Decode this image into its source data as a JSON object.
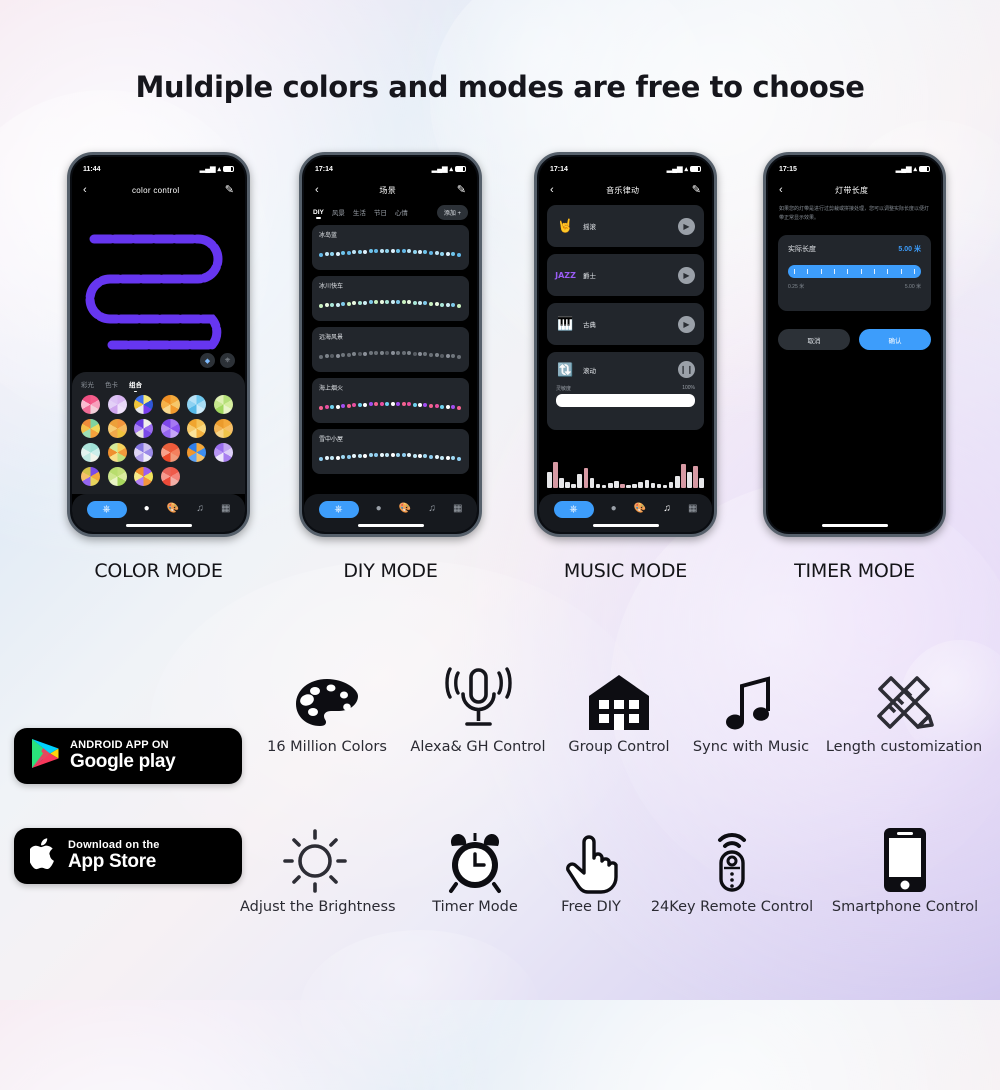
{
  "heading": "Muldiple colors and modes are free to choose",
  "colors": {
    "accent_blue": "#3d9dfb",
    "strip_purple": "#6636f0",
    "phone_bezel": "#56606b",
    "card_dark": "#22262c",
    "panel_dark": "#1d2025"
  },
  "phones": [
    {
      "id": "color-mode",
      "mode_label": "COLOR MODE",
      "status_time": "11:44",
      "nav_title": "color control",
      "back_icon": "chevron-left-icon",
      "edit_icon": "pencil-icon",
      "tabs": [
        {
          "label": "彩光",
          "active": false
        },
        {
          "label": "色卡",
          "active": false
        },
        {
          "label": "组合",
          "active": true
        }
      ],
      "fab_icons": [
        "diamond-icon",
        "power-icon"
      ],
      "swatch_count": 22,
      "tabbar": {
        "power_icon": "power-icon",
        "items": [
          {
            "icon": "bulb-icon",
            "active": true
          },
          {
            "icon": "palette-icon",
            "active": false
          },
          {
            "icon": "music-note-icon",
            "active": false
          },
          {
            "icon": "grid-icon",
            "active": false
          }
        ]
      }
    },
    {
      "id": "diy-mode",
      "mode_label": "DIY MODE",
      "status_time": "17:14",
      "nav_title": "场景",
      "back_icon": "chevron-left-icon",
      "edit_icon": "pencil-icon",
      "category_tabs": [
        {
          "label": "DIY",
          "active": true
        },
        {
          "label": "风景",
          "active": false
        },
        {
          "label": "生活",
          "active": false
        },
        {
          "label": "节日",
          "active": false
        },
        {
          "label": "心情",
          "active": false
        }
      ],
      "add_button": "添加 +",
      "scenes": [
        {
          "name": "冰岛蓝",
          "palette": [
            "#63b8e8",
            "#bfe4f5",
            "#8fd4f0",
            "#ddf0fb",
            "#6fc4ec"
          ]
        },
        {
          "name": "冰川快车",
          "palette": [
            "#c9f0c0",
            "#e8f8e0",
            "#a9e6d8",
            "#cfeef4",
            "#7fc9ea"
          ]
        },
        {
          "name": "远海风景",
          "palette": [
            "#6a6f76",
            "#7e848b",
            "#585d64",
            "#8b9099",
            "#6f757c"
          ]
        },
        {
          "name": "海上烟火",
          "palette": [
            "#f4628f",
            "#e84fa0",
            "#6fd2f0",
            "#ffffff",
            "#a24ef0"
          ]
        },
        {
          "name": "雪中小屋",
          "palette": [
            "#8ecdf0",
            "#e8f6fb",
            "#bfe6f5",
            "#ffffff",
            "#9fd8f2"
          ]
        }
      ],
      "tabbar": {
        "power_icon": "power-icon",
        "items": [
          {
            "icon": "bulb-icon",
            "active": false
          },
          {
            "icon": "palette-icon",
            "active": true
          },
          {
            "icon": "music-note-icon",
            "active": false
          },
          {
            "icon": "grid-icon",
            "active": false
          }
        ]
      }
    },
    {
      "id": "music-mode",
      "mode_label": "MUSIC MODE",
      "status_time": "17:14",
      "nav_title": "音乐律动",
      "back_icon": "chevron-left-icon",
      "edit_icon": "pencil-icon",
      "tracks": [
        {
          "name": "摇滚",
          "icon": "rock-hand-icon",
          "control": "play-icon",
          "playing": false
        },
        {
          "name": "爵士",
          "icon": "jazz-text-icon",
          "control": "play-icon",
          "playing": false
        },
        {
          "name": "古典",
          "icon": "piano-icon",
          "control": "play-icon",
          "playing": false
        },
        {
          "name": "滚动",
          "icon": "cycle-icon",
          "control": "pause-icon",
          "playing": true
        }
      ],
      "sensitivity_label": "灵敏度",
      "sensitivity_value": "100%",
      "tabbar": {
        "power_icon": "power-icon",
        "items": [
          {
            "icon": "bulb-icon",
            "active": false
          },
          {
            "icon": "palette-icon",
            "active": false
          },
          {
            "icon": "music-note-icon",
            "active": true
          },
          {
            "icon": "grid-icon",
            "active": false
          }
        ]
      }
    },
    {
      "id": "timer-mode",
      "mode_label": "TIMER MODE",
      "status_time": "17:15",
      "nav_title": "灯带长度",
      "back_icon": "chevron-left-icon",
      "description": "如果您的灯带是进行过剪裁或拼接处理，您可以调整实际长度以便灯带正常显示效果。",
      "length_label": "实际长度",
      "length_value": "5.00 米",
      "range_min": "0.25 米",
      "range_max": "5.00 米",
      "cancel_button": "取消",
      "confirm_button": "确认"
    }
  ],
  "store_badges": [
    {
      "id": "google-play",
      "line1": "ANDROID APP ON",
      "line2": "Google play",
      "icon": "google-play-icon"
    },
    {
      "id": "app-store",
      "line1": "Download on the",
      "line2": "App Store",
      "icon": "apple-logo-icon"
    }
  ],
  "features": [
    {
      "label": "16 Million Colors",
      "icon": "palette-icon"
    },
    {
      "label": "Alexa& GH Control",
      "icon": "microphone-icon"
    },
    {
      "label": "Group Control",
      "icon": "house-icon"
    },
    {
      "label": "Sync with Music",
      "icon": "music-note-icon"
    },
    {
      "label": "Length customization",
      "icon": "ruler-pencil-icon"
    },
    {
      "label": "Adjust the Brightness",
      "icon": "sun-icon"
    },
    {
      "label": "Timer Mode",
      "icon": "alarm-clock-icon"
    },
    {
      "label": "Free DIY",
      "icon": "pointing-hand-icon"
    },
    {
      "label": "24Key Remote Control",
      "icon": "remote-control-icon"
    },
    {
      "label": "Smartphone Control",
      "icon": "smartphone-icon"
    }
  ]
}
